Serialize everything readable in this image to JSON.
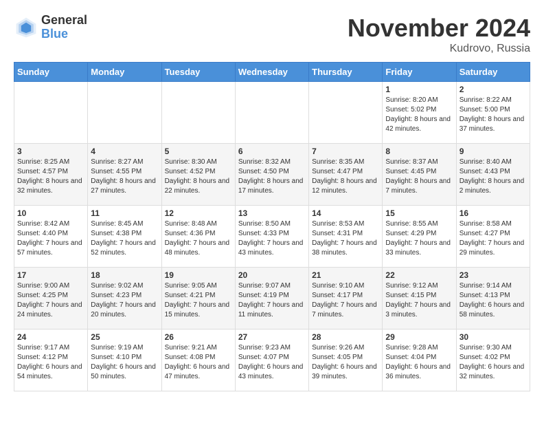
{
  "header": {
    "logo_general": "General",
    "logo_blue": "Blue",
    "month_title": "November 2024",
    "location": "Kudrovo, Russia"
  },
  "days_of_week": [
    "Sunday",
    "Monday",
    "Tuesday",
    "Wednesday",
    "Thursday",
    "Friday",
    "Saturday"
  ],
  "weeks": [
    [
      {
        "day": "",
        "info": ""
      },
      {
        "day": "",
        "info": ""
      },
      {
        "day": "",
        "info": ""
      },
      {
        "day": "",
        "info": ""
      },
      {
        "day": "",
        "info": ""
      },
      {
        "day": "1",
        "info": "Sunrise: 8:20 AM\nSunset: 5:02 PM\nDaylight: 8 hours and 42 minutes."
      },
      {
        "day": "2",
        "info": "Sunrise: 8:22 AM\nSunset: 5:00 PM\nDaylight: 8 hours and 37 minutes."
      }
    ],
    [
      {
        "day": "3",
        "info": "Sunrise: 8:25 AM\nSunset: 4:57 PM\nDaylight: 8 hours and 32 minutes."
      },
      {
        "day": "4",
        "info": "Sunrise: 8:27 AM\nSunset: 4:55 PM\nDaylight: 8 hours and 27 minutes."
      },
      {
        "day": "5",
        "info": "Sunrise: 8:30 AM\nSunset: 4:52 PM\nDaylight: 8 hours and 22 minutes."
      },
      {
        "day": "6",
        "info": "Sunrise: 8:32 AM\nSunset: 4:50 PM\nDaylight: 8 hours and 17 minutes."
      },
      {
        "day": "7",
        "info": "Sunrise: 8:35 AM\nSunset: 4:47 PM\nDaylight: 8 hours and 12 minutes."
      },
      {
        "day": "8",
        "info": "Sunrise: 8:37 AM\nSunset: 4:45 PM\nDaylight: 8 hours and 7 minutes."
      },
      {
        "day": "9",
        "info": "Sunrise: 8:40 AM\nSunset: 4:43 PM\nDaylight: 8 hours and 2 minutes."
      }
    ],
    [
      {
        "day": "10",
        "info": "Sunrise: 8:42 AM\nSunset: 4:40 PM\nDaylight: 7 hours and 57 minutes."
      },
      {
        "day": "11",
        "info": "Sunrise: 8:45 AM\nSunset: 4:38 PM\nDaylight: 7 hours and 52 minutes."
      },
      {
        "day": "12",
        "info": "Sunrise: 8:48 AM\nSunset: 4:36 PM\nDaylight: 7 hours and 48 minutes."
      },
      {
        "day": "13",
        "info": "Sunrise: 8:50 AM\nSunset: 4:33 PM\nDaylight: 7 hours and 43 minutes."
      },
      {
        "day": "14",
        "info": "Sunrise: 8:53 AM\nSunset: 4:31 PM\nDaylight: 7 hours and 38 minutes."
      },
      {
        "day": "15",
        "info": "Sunrise: 8:55 AM\nSunset: 4:29 PM\nDaylight: 7 hours and 33 minutes."
      },
      {
        "day": "16",
        "info": "Sunrise: 8:58 AM\nSunset: 4:27 PM\nDaylight: 7 hours and 29 minutes."
      }
    ],
    [
      {
        "day": "17",
        "info": "Sunrise: 9:00 AM\nSunset: 4:25 PM\nDaylight: 7 hours and 24 minutes."
      },
      {
        "day": "18",
        "info": "Sunrise: 9:02 AM\nSunset: 4:23 PM\nDaylight: 7 hours and 20 minutes."
      },
      {
        "day": "19",
        "info": "Sunrise: 9:05 AM\nSunset: 4:21 PM\nDaylight: 7 hours and 15 minutes."
      },
      {
        "day": "20",
        "info": "Sunrise: 9:07 AM\nSunset: 4:19 PM\nDaylight: 7 hours and 11 minutes."
      },
      {
        "day": "21",
        "info": "Sunrise: 9:10 AM\nSunset: 4:17 PM\nDaylight: 7 hours and 7 minutes."
      },
      {
        "day": "22",
        "info": "Sunrise: 9:12 AM\nSunset: 4:15 PM\nDaylight: 7 hours and 3 minutes."
      },
      {
        "day": "23",
        "info": "Sunrise: 9:14 AM\nSunset: 4:13 PM\nDaylight: 6 hours and 58 minutes."
      }
    ],
    [
      {
        "day": "24",
        "info": "Sunrise: 9:17 AM\nSunset: 4:12 PM\nDaylight: 6 hours and 54 minutes."
      },
      {
        "day": "25",
        "info": "Sunrise: 9:19 AM\nSunset: 4:10 PM\nDaylight: 6 hours and 50 minutes."
      },
      {
        "day": "26",
        "info": "Sunrise: 9:21 AM\nSunset: 4:08 PM\nDaylight: 6 hours and 47 minutes."
      },
      {
        "day": "27",
        "info": "Sunrise: 9:23 AM\nSunset: 4:07 PM\nDaylight: 6 hours and 43 minutes."
      },
      {
        "day": "28",
        "info": "Sunrise: 9:26 AM\nSunset: 4:05 PM\nDaylight: 6 hours and 39 minutes."
      },
      {
        "day": "29",
        "info": "Sunrise: 9:28 AM\nSunset: 4:04 PM\nDaylight: 6 hours and 36 minutes."
      },
      {
        "day": "30",
        "info": "Sunrise: 9:30 AM\nSunset: 4:02 PM\nDaylight: 6 hours and 32 minutes."
      }
    ]
  ]
}
